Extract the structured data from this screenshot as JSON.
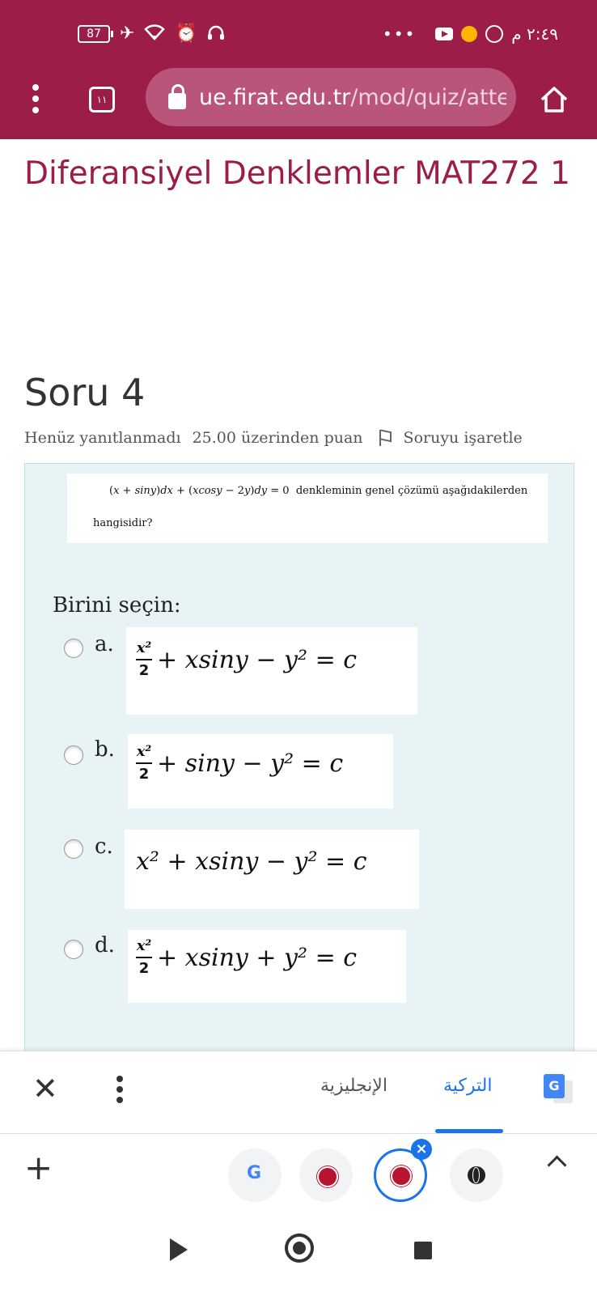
{
  "status_bar": {
    "battery": "87",
    "clock": "٢:٤٩ م",
    "overflow": "•••"
  },
  "browser": {
    "tab_count": "١١",
    "url_host": "ue.firat.edu.tr",
    "url_path": "/mod/quiz/atte"
  },
  "page": {
    "course_title": "Diferansiyel Denklemler MAT272 1",
    "question_title": "Soru 4",
    "status": "Henüz yanıtlanmadı",
    "points": "25.00 üzerinden puan",
    "flag_label": "Soruyu işaretle",
    "question_text_rest": "denkleminin genel çözümü aşağıdakilerden",
    "question_text_line2": "hangisidir?",
    "prompt": "Birini seçin:"
  },
  "options": [
    {
      "letter": "a.",
      "term1": "x²/2",
      "rest": "+ xsiny − y² = c"
    },
    {
      "letter": "b.",
      "term1": "x²/2",
      "rest": "+ siny − y² = c"
    },
    {
      "letter": "c.",
      "term1": "x²",
      "rest": "+ xsiny − y² = c"
    },
    {
      "letter": "d.",
      "term1": "x²/2",
      "rest": "+ xsiny + y² = c"
    }
  ],
  "translate": {
    "lang_source": "التركية",
    "lang_target": "الإنجليزية"
  },
  "colors": {
    "brand": "#9c1d47",
    "panel": "#e7f3f5",
    "accent": "#1a73e8"
  }
}
